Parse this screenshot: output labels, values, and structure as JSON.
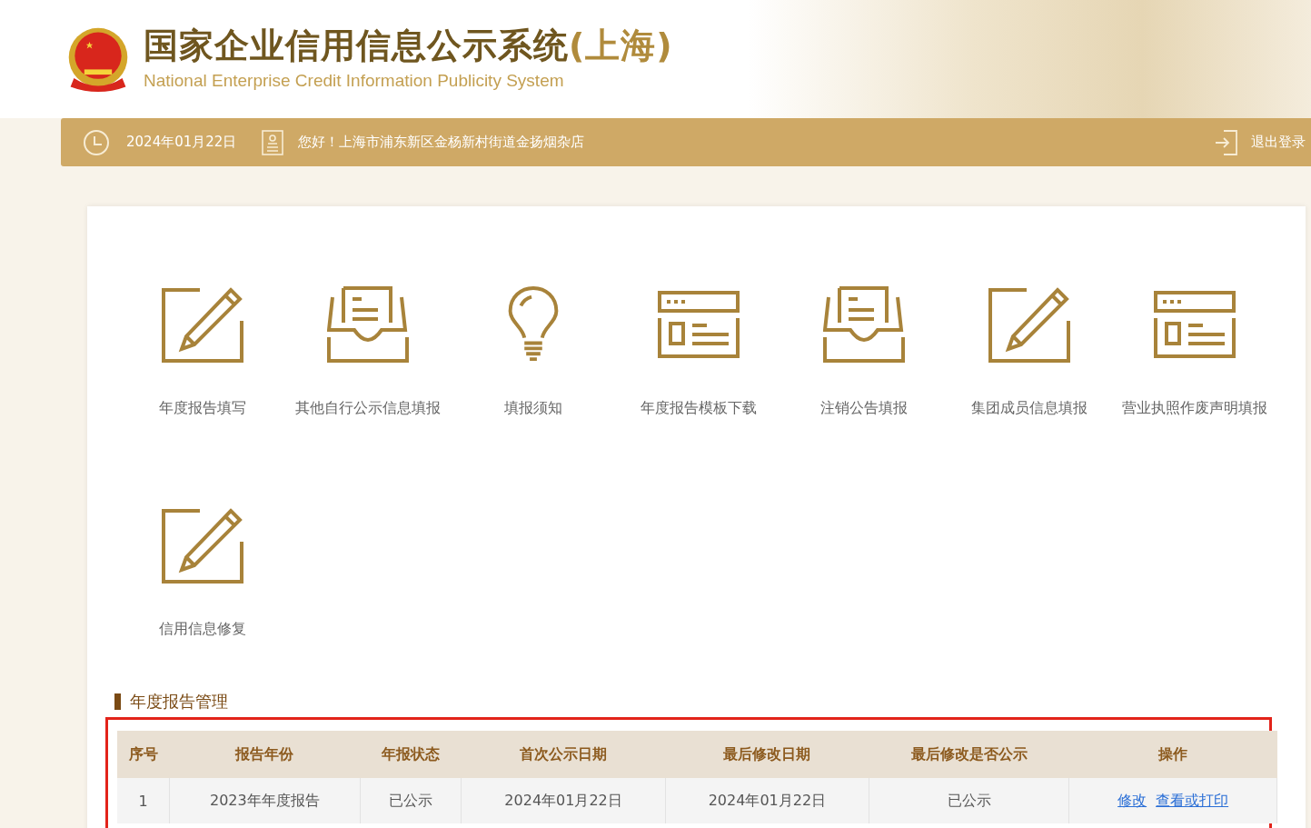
{
  "header": {
    "title_cn": "国家企业信用信息公示系统",
    "title_region": "(上海)",
    "title_en": "National Enterprise Credit Information Publicity System"
  },
  "top_bar": {
    "date": "2024年01月22日",
    "greeting": "您好！上海市浦东新区金杨新村街道金扬烟杂店",
    "logout": "退出登录"
  },
  "tiles": [
    {
      "kind": "edit",
      "label": "年度报告填写"
    },
    {
      "kind": "tray",
      "label": "其他自行公示信息填报"
    },
    {
      "kind": "bulb",
      "label": "填报须知"
    },
    {
      "kind": "form",
      "label": "年度报告模板下载"
    },
    {
      "kind": "tray",
      "label": "注销公告填报"
    },
    {
      "kind": "edit",
      "label": "集团成员信息填报"
    },
    {
      "kind": "form",
      "label": "营业执照作废声明填报"
    },
    {
      "kind": "edit",
      "label": "信用信息修复"
    }
  ],
  "section": {
    "title": "年度报告管理",
    "highlighted": true
  },
  "table": {
    "columns": [
      "序号",
      "报告年份",
      "年报状态",
      "首次公示日期",
      "最后修改日期",
      "最后修改是否公示",
      "操作"
    ],
    "rows": [
      {
        "cells": [
          "1",
          "2023年年度报告",
          "已公示",
          "2024年01月22日",
          "2024年01月22日",
          "已公示"
        ],
        "actions": [
          "修改",
          "查看或打印"
        ]
      }
    ]
  }
}
